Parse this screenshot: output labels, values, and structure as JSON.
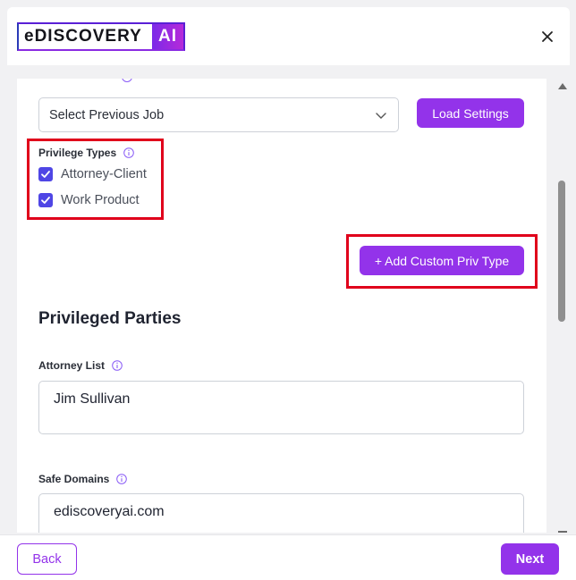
{
  "header": {
    "logo_part1": "eDISCOVERY",
    "logo_part2": "AI"
  },
  "job": {
    "select_value": "Select Previous Job",
    "load_button": "Load Settings"
  },
  "privilege_types": {
    "label": "Privilege Types",
    "options": [
      {
        "label": "Attorney-Client",
        "checked": true
      },
      {
        "label": "Work Product",
        "checked": true
      }
    ],
    "add_button": "+ Add Custom Priv Type"
  },
  "privileged_parties": {
    "title": "Privileged Parties",
    "attorney_list_label": "Attorney List",
    "attorney_list_value": "Jim Sullivan",
    "safe_domains_label": "Safe Domains",
    "safe_domains_value": "ediscoveryai.com"
  },
  "footer": {
    "back": "Back",
    "next": "Next"
  },
  "colors": {
    "accent": "#9333ea",
    "checkbox": "#4f46e5",
    "highlight": "#e0001b"
  }
}
